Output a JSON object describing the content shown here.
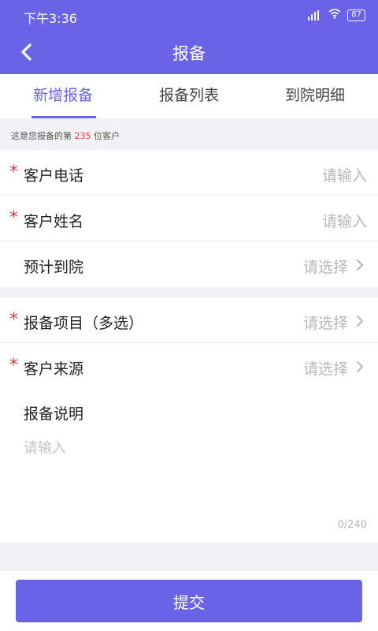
{
  "status_bar": {
    "time": "下午3:36",
    "battery": "87"
  },
  "header": {
    "title": "报备",
    "back_icon": "chevron-left-icon"
  },
  "tabs": [
    {
      "label": "新增报备",
      "active": true
    },
    {
      "label": "报备列表",
      "active": false
    },
    {
      "label": "到院明细",
      "active": false
    }
  ],
  "notice": {
    "prefix": "这是您报备的第",
    "count": "235",
    "suffix": "位客户"
  },
  "form": {
    "phone": {
      "required": "*",
      "label": "客户电话",
      "placeholder": "请输入"
    },
    "name": {
      "required": "*",
      "label": "客户姓名",
      "placeholder": "请输入"
    },
    "visit": {
      "label": "预计到院",
      "placeholder": "请选择"
    },
    "project": {
      "required": "*",
      "label": "报备项目（多选）",
      "placeholder": "请选择"
    },
    "source": {
      "required": "*",
      "label": "客户来源",
      "placeholder": "请选择"
    },
    "memo": {
      "label": "报备说明",
      "placeholder": "请输入",
      "counter": "0/240"
    }
  },
  "footer": {
    "submit_label": "提交"
  },
  "colors": {
    "primary": "#6b63e6",
    "required": "#e53935",
    "placeholder": "#b7b7b7"
  }
}
